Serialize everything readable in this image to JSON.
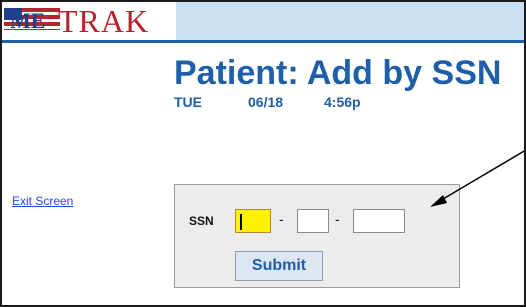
{
  "app": {
    "logo_text": "TRAK",
    "logo_prefix": "ME"
  },
  "header": {
    "title": "Patient: Add by SSN",
    "day": "TUE",
    "date": "06/18",
    "time": "4:56p"
  },
  "nav": {
    "exit_label": "Exit Screen"
  },
  "form": {
    "ssn_label": "SSN",
    "separator": "-",
    "part1_value": "",
    "part2_value": "",
    "part3_value": "",
    "submit_label": "Submit"
  },
  "colors": {
    "title_blue": "#1f5fa8",
    "logo_red": "#b8242b",
    "active_field": "#fff200",
    "header_band": "#c9e0f2",
    "panel_bg": "#ececea",
    "link_blue": "#1a4fd6"
  },
  "icons": {
    "logo": "medtrak-flag-logo",
    "annotation": "pointer-arrow"
  }
}
